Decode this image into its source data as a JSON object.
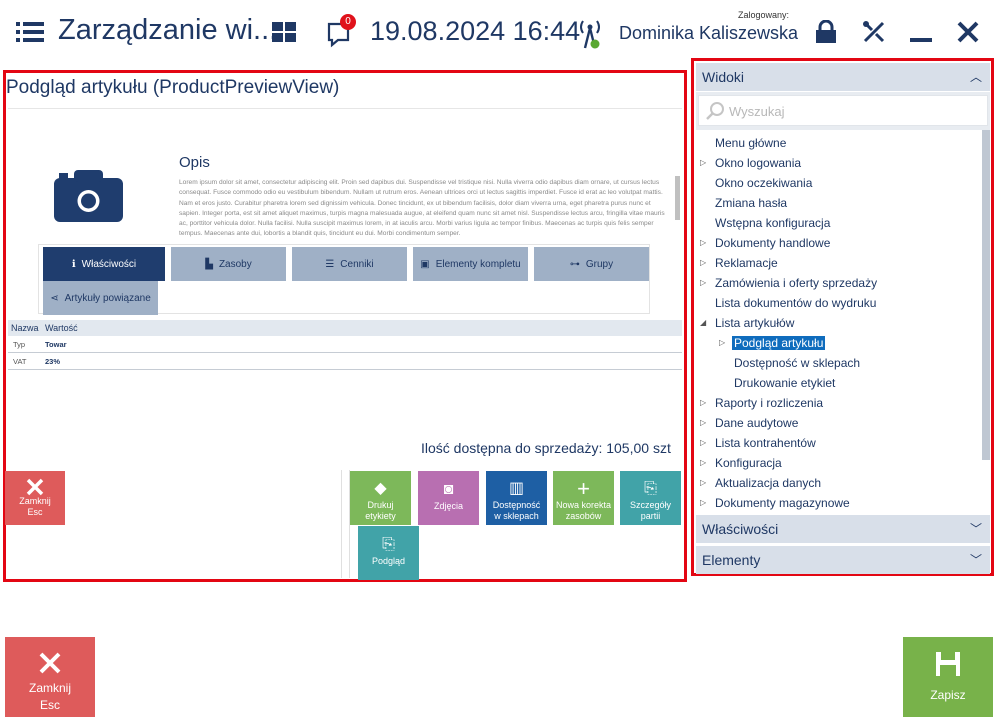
{
  "header": {
    "title": "Zarządzanie wi...",
    "notification_count": "0",
    "datetime": "19.08.2024 16:44",
    "logged_label": "Zalogowany:",
    "user": "Dominika Kaliszewska"
  },
  "preview": {
    "title": "Podgląd artykułu (ProductPreviewView)",
    "description_title": "Opis",
    "description_text": "Lorem ipsum dolor sit amet, consectetur adipiscing elit. Proin sed dapibus dui. Suspendisse vel tristique nisi. Nulla viverra odio dapibus diam ornare, ut cursus lectus consequat. Fusce commodo odio eu vestibulum bibendum. Nullam ut rutrum eros. Aenean ultrices orci ut lectus sagittis imperdiet. Fusce id erat ac leo volutpat mattis. Nam et eros justo. Curabitur pharetra lorem sed dignissim vehicula. Donec tincidunt, ex ut bibendum facilisis, dolor diam viverra urna, eget pharetra purus nunc et sapien. Integer porta, est sit amet aliquet maximus, turpis magna malesuada augue, at eleifend quam nunc sit amet nisl. Suspendisse lectus arcu, fringilla vitae mauris ac, porttitor vehicula dolor. Nulla facilisi. Nulla suscipit maximus lorem, in at iaculis arcu. Morbi varius ligula ac tempor finibus. Maecenas ac turpis quis felis semper tempus. Maecenas ante dui, lobortis a blandit quis, tincidunt eu dui. Morbi condimentum semper.",
    "tabs": [
      {
        "label": "Właściwości",
        "icon": "info-icon"
      },
      {
        "label": "Zasoby",
        "icon": "stock-icon"
      },
      {
        "label": "Cenniki",
        "icon": "list-icon"
      },
      {
        "label": "Elementy kompletu",
        "icon": "gift-icon"
      },
      {
        "label": "Grupy",
        "icon": "tree-icon"
      },
      {
        "label": "Artykuły powiązane",
        "icon": "share-icon"
      }
    ],
    "props_headers": [
      "Nazwa",
      "Wartość"
    ],
    "props_rows": [
      {
        "name": "Typ",
        "value": "Towar"
      },
      {
        "name": "VAT",
        "value": "23%"
      }
    ],
    "qty_label": "Ilość dostępna do sprzedaży:",
    "qty_value": "105,00 szt",
    "close_label": "Zamknij",
    "close_key": "Esc",
    "actions": [
      {
        "label1": "Drukuj",
        "label2": "etykiety",
        "color": "#7db85a",
        "icon": "tag-icon"
      },
      {
        "label1": "Zdjęcia",
        "label2": "",
        "color": "#b86fb1",
        "icon": "photo-icon"
      },
      {
        "label1": "Dostępność",
        "label2": "w sklepach",
        "color": "#1e5fa4",
        "icon": "warehouse-icon"
      },
      {
        "label1": "Nowa korekta",
        "label2": "zasobów",
        "color": "#7db85a",
        "icon": "plus-icon"
      },
      {
        "label1": "Szczegóły",
        "label2": "partii",
        "color": "#41a3a8",
        "icon": "doc-search-icon"
      },
      {
        "label1": "Podgląd",
        "label2": "",
        "color": "#41a3a8",
        "icon": "doc-search-icon"
      }
    ]
  },
  "sidebar": {
    "widoki_label": "Widoki",
    "search_placeholder": "Wyszukaj",
    "tree": [
      {
        "label": "Menu główne",
        "arrow": ""
      },
      {
        "label": "Okno logowania",
        "arrow": "▷"
      },
      {
        "label": "Okno oczekiwania",
        "arrow": ""
      },
      {
        "label": "Zmiana hasła",
        "arrow": ""
      },
      {
        "label": "Wstępna konfiguracja",
        "arrow": ""
      },
      {
        "label": "Dokumenty handlowe",
        "arrow": "▷"
      },
      {
        "label": "Reklamacje",
        "arrow": "▷"
      },
      {
        "label": "Zamówienia i oferty sprzedaży",
        "arrow": "▷"
      },
      {
        "label": "Lista dokumentów do wydruku",
        "arrow": ""
      },
      {
        "label": "Lista artykułów",
        "arrow": "◢"
      },
      {
        "label": "Podgląd artykułu",
        "arrow": "▷"
      },
      {
        "label": "Dostępność w sklepach",
        "arrow": ""
      },
      {
        "label": "Drukowanie etykiet",
        "arrow": ""
      },
      {
        "label": "Raporty i rozliczenia",
        "arrow": "▷"
      },
      {
        "label": "Dane audytowe",
        "arrow": "▷"
      },
      {
        "label": "Lista kontrahentów",
        "arrow": "▷"
      },
      {
        "label": "Konfiguracja",
        "arrow": "▷"
      },
      {
        "label": "Aktualizacja danych",
        "arrow": "▷"
      },
      {
        "label": "Dokumenty magazynowe",
        "arrow": "▷"
      }
    ],
    "wlasciwosci_label": "Właściwości",
    "elementy_label": "Elementy"
  },
  "footer": {
    "close_label": "Zamknij",
    "close_key": "Esc",
    "save_label": "Zapisz"
  }
}
